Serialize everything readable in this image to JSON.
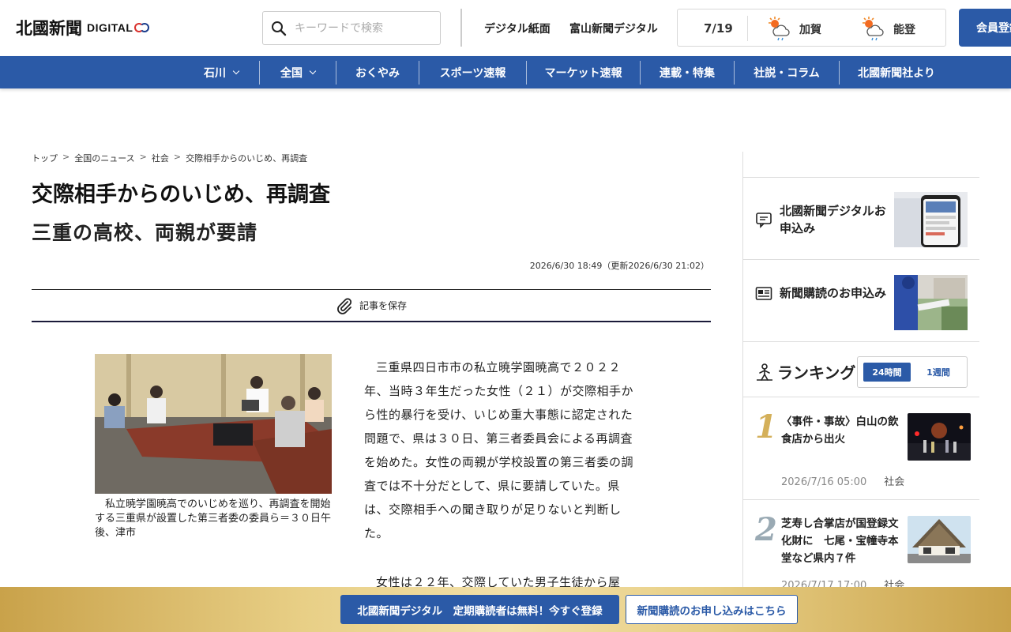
{
  "header": {
    "logo_text": "北國新聞",
    "logo_digital": "DIGITAL",
    "search_placeholder": "キーワードで検索",
    "link_paper": "デジタル紙面",
    "link_toyama": "富山新聞デジタル",
    "weather": {
      "date": "7/19",
      "locations": [
        {
          "name": "加賀",
          "icon": "sun-cloud-rain-icon"
        },
        {
          "name": "能登",
          "icon": "sun-cloud-rain-icon"
        }
      ]
    },
    "member_button": "会員登録"
  },
  "nav": {
    "items": [
      {
        "label": "石川",
        "dropdown": true
      },
      {
        "label": "全国",
        "dropdown": true
      },
      {
        "label": "おくやみ",
        "dropdown": false
      },
      {
        "label": "スポーツ速報",
        "dropdown": false
      },
      {
        "label": "マーケット速報",
        "dropdown": false
      },
      {
        "label": "連載・特集",
        "dropdown": false
      },
      {
        "label": "社説・コラム",
        "dropdown": false
      },
      {
        "label": "北國新聞社より",
        "dropdown": false
      }
    ]
  },
  "article": {
    "breadcrumb": [
      "トップ",
      "全国のニュース",
      "社会",
      "交際相手からのいじめ、再調査"
    ],
    "breadcrumb_sep": ">",
    "title": "交際相手からのいじめ、再調査",
    "subtitle": "三重の高校、両親が要請",
    "timestamp": "2026/6/30 18:49（更新2026/6/30 21:02）",
    "save_label": "記事を保存",
    "caption": "私立暁学園暁高でのいじめを巡り、再調査を開始する三重県が設置した第三者委の委員ら＝３０日午後、津市",
    "paragraph1": "三重県四日市市の私立暁学園暁高で２０２２年、当時３年生だった女性（２１）が交際相手から性的暴行を受け、いじめ重大事態に認定された問題で、県は３０日、第三者委員会による再調査を始めた。女性の両親が学校設置の第三者委の調査では不十分だとして、県に要請していた。県は、交際相手への聞き取りが足りないと判断した。",
    "paragraph2": "女性は２２年、交際していた男子生徒から屋"
  },
  "sidebar": {
    "promos": [
      {
        "label": "北國新聞デジタルお申込み",
        "icon": "digital-subscription-icon"
      },
      {
        "label": "新聞購読のお申込み",
        "icon": "newspaper-icon"
      }
    ],
    "ranking": {
      "title": "ランキング",
      "tabs": [
        "24時間",
        "1週間"
      ],
      "active_tab": "24時間",
      "items": [
        {
          "rank": "1",
          "title": "〈事件・事故〉白山の飲食店から出火",
          "date": "2026/7/16 05:00",
          "category": "社会"
        },
        {
          "rank": "2",
          "title": "芝寿し合掌店が国登録文化財に　七尾・宝幢寺本堂など県内７件",
          "date": "2026/7/17 17:00",
          "category": "社会"
        }
      ]
    }
  },
  "banner": {
    "digital_button": "北國新聞デジタル　定期購読者は無料！今すぐ登録",
    "paper_button": "新聞購読のお申し込みはこちら"
  },
  "colors": {
    "brand_blue": "#2b5aa7",
    "rank_gold": "#d4b05a",
    "rank_silver": "#9aaab4"
  }
}
